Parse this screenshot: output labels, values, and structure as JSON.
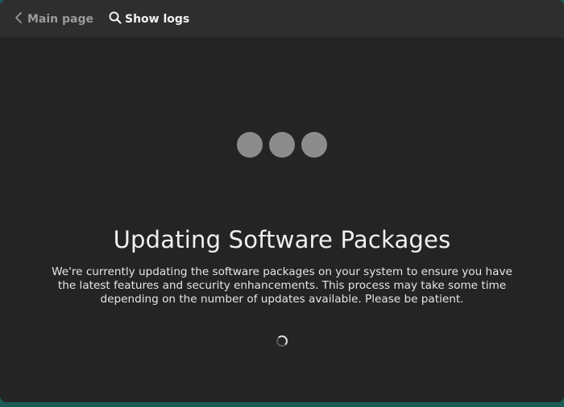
{
  "header": {
    "back_label": "Main page",
    "logs_label": "Show logs"
  },
  "main": {
    "title": "Updating Software Packages",
    "description": "We're currently updating the software packages on your system to ensure you have the latest features and security enhancements. This process may take some time depending on the number of updates available. Please be patient."
  },
  "icons": {
    "back": "chevron-left-icon",
    "logs": "search-icon",
    "loading_dots": "loading-dots-icon",
    "spinner": "spinner-icon"
  },
  "colors": {
    "window_bg": "#242424",
    "header_bg": "#2e2e2e",
    "dot": "#8c8c8c"
  }
}
